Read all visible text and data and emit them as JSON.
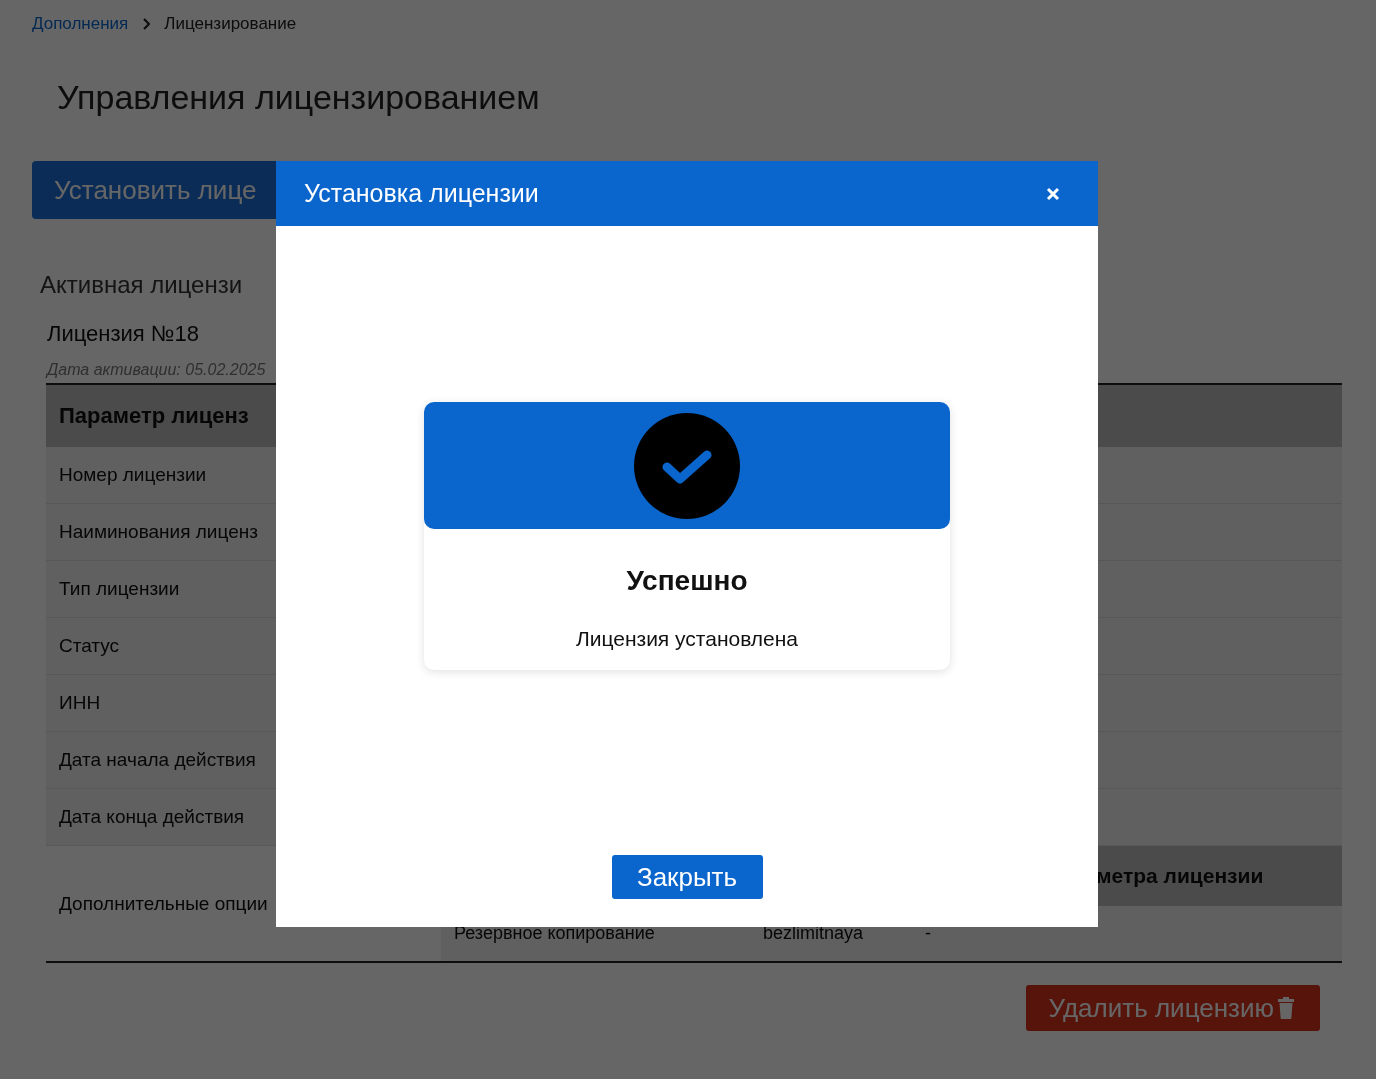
{
  "breadcrumb": [
    {
      "label": "Дополнения",
      "kind": "link"
    },
    {
      "label": "Лицензирование",
      "kind": "current"
    }
  ],
  "page_title": "Управления лицензированием",
  "install_button": "Установить лице",
  "active_license": {
    "heading": "Активная лицензи",
    "name": "Лицензия №18",
    "activation_date": "Дата активации: 05.02.2025"
  },
  "table": {
    "header": "Параметр лиценз",
    "rows": [
      {
        "label": "Номер лицензии"
      },
      {
        "label": "Наиминования лиценз"
      },
      {
        "label": "Тип лицензии"
      },
      {
        "label": "Статус"
      },
      {
        "label": "ИНН"
      },
      {
        "label": "Дата начала действия"
      },
      {
        "label": "Дата конца действия"
      }
    ],
    "options_row": {
      "label": "Дополнительные опции",
      "subtable": {
        "header": "метра лицензии",
        "rows": [
          {
            "cells": [
              "Резервное копирование",
              "bezlimitnaya",
              "-"
            ]
          }
        ]
      }
    }
  },
  "delete_button": "Удалить лицензию",
  "modal": {
    "title": "Установка лицензии",
    "success": {
      "title": "Успешно",
      "message": "Лицензия установлена"
    },
    "close_button": "Закрыть"
  }
}
